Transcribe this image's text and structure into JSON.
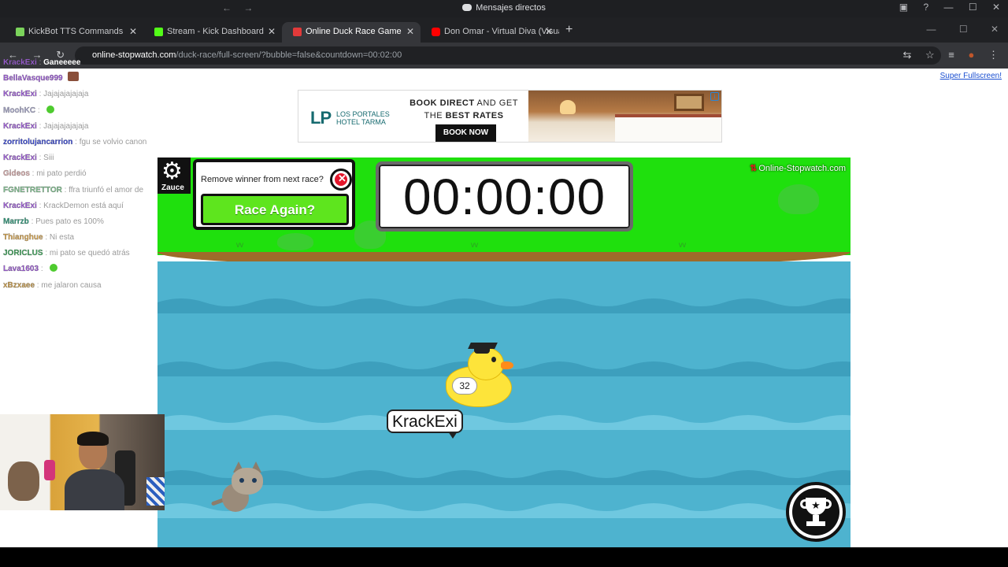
{
  "os": {
    "nav": "← →",
    "title": "Mensajes directos",
    "controls": [
      "▣",
      "?",
      "—",
      "☐",
      "✕"
    ]
  },
  "tabs": [
    {
      "label": "KickBot TTS Commands",
      "favicon_color": "#7bd35b",
      "active": false
    },
    {
      "label": "Stream - Kick Dashboard",
      "favicon_color": "#53fc18",
      "active": false
    },
    {
      "label": "Online Duck Race Game",
      "favicon_color": "#e23a3a",
      "active": true
    },
    {
      "label": "Don Omar - Virtual Diva (Visual",
      "favicon_color": "#ff0000",
      "active": false
    }
  ],
  "tab_close": "✕",
  "new_tab": "+",
  "window_controls": [
    "—",
    "☐",
    "✕"
  ],
  "address": {
    "nav_buttons": [
      "←",
      "→",
      "↻"
    ],
    "url_host": "online-stopwatch.com",
    "url_path": "/duck-race/full-screen/?bubble=false&countdown=00:02:00",
    "right_icons": [
      "⇆",
      "☆",
      "≡",
      "●",
      "⋮"
    ]
  },
  "page": {
    "super_fullscreen": "Super Fullscreen!",
    "ad": {
      "logo": "LP",
      "hotel_name_1": "LOS PORTALES",
      "hotel_name_2": "HOTEL TARMA",
      "headline_1a": "BOOK DIRECT",
      "headline_1b": " AND GET",
      "headline_2a": "THE ",
      "headline_2b": "BEST RATES",
      "cta": "BOOK NOW",
      "ad_icon": "i"
    },
    "game": {
      "settings_icon": "⚙",
      "settings_user": "Zauce",
      "remove_winner_question": "Remove winner from next race?",
      "remove_winner_close": "✕",
      "race_again": "Race Again?",
      "timer": "00:00:00",
      "brand": "Online-Stopwatch.com",
      "brand_arrows": "⇅",
      "duck_name": "KrackExi",
      "duck_number": "32",
      "trophy_star": "★"
    }
  },
  "chat": [
    {
      "user": "KrackExi",
      "color": "#9b59d6",
      "message": "Ganeeeee"
    },
    {
      "user": "BellaVasque999",
      "color": "#9b59d6",
      "message": "",
      "emote": "brown"
    },
    {
      "user": "KrackExi",
      "color": "#9b59d6",
      "message": "Jajajajajajaja"
    },
    {
      "user": "MoohKC",
      "color": "#a7a7c9",
      "message": "",
      "emote": "green"
    },
    {
      "user": "KrackExi",
      "color": "#9b59d6",
      "message": "Jajajajajajaja"
    },
    {
      "user": "zorritolujancarrion",
      "color": "#3a4ad6",
      "message": "fgu se volvio canon"
    },
    {
      "user": "KrackExi",
      "color": "#9b59d6",
      "message": "Siii"
    },
    {
      "user": "Gideos",
      "color": "#d6a9a9",
      "message": "mi pato perdió"
    },
    {
      "user": "FGNETRETTOR",
      "color": "#7fbf8f",
      "message": "ffra triunfó el amor de"
    },
    {
      "user": "KrackExi",
      "color": "#9b59d6",
      "message": "KrackDemon está aquí"
    },
    {
      "user": "Marrzb",
      "color": "#2f9b7c",
      "message": "Pues pato es 100%"
    },
    {
      "user": "Thianghue",
      "color": "#d6a24a",
      "message": "Ni esta"
    },
    {
      "user": "JORICLUS",
      "color": "#3ea35a",
      "message": "mi pato se quedó atrás"
    },
    {
      "user": "Lava1603",
      "color": "#9b59d6",
      "message": "",
      "emote": "green"
    },
    {
      "user": "xBzxaee",
      "color": "#c89b4a",
      "message": "me jalaron causa"
    }
  ]
}
